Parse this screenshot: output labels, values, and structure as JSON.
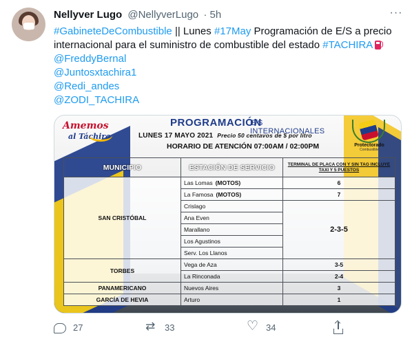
{
  "tweet": {
    "author_name": "Nellyver Lugo",
    "author_handle": "@NellyverLugo",
    "time": "· 5h",
    "more_icon": "more-horizontal-icon",
    "text": {
      "l1_hashtag1": "#GabineteDeCombustible",
      "l1_mid": " || Lunes ",
      "l1_hashtag2": "#17May",
      "l1_rest": " Programación de E/S a precio",
      "l2_text": "internacional para el suministro de combustible  del estado ",
      "l2_hashtag": "#TACHIRA",
      "l2_emoji": "fuel-pump-icon",
      "mentions": [
        "@FreddyBernal",
        "@Juntosxtachira1",
        "@Redi_andes",
        "@ZODI_TACHIRA"
      ]
    },
    "colors": {
      "link": "#1d9bf0",
      "secondary": "#536471",
      "text": "#0f1419"
    }
  },
  "image": {
    "logo_left_line1": "Amemos",
    "logo_left_line2": "al Táchira",
    "title": "PROGRAMACIÓN",
    "subtitle": "E/S INTERNACIONALES",
    "date": "LUNES  17  MAYO 2021",
    "price_note": "Precio 50 centavos de $ por litro",
    "hours": "HORARIO DE ATENCIÓN 07:00AM / 02:00PM",
    "logo_right_line1": "Protectorado",
    "logo_right_line2": "Combustible",
    "table": {
      "headers": [
        "MUNICIPIO",
        "ESTACIÓN DE SERVICIO",
        "TERMINAL DE PLACA CON Y SIN TAG INCLUYE TAXI Y 5 PUESTOS"
      ],
      "municipalities": [
        "SAN CRISTÓBAL",
        "TORBES",
        "PANAMERICANO",
        "GARCÍA DE HEVIA"
      ],
      "stations": [
        {
          "name": "Las Lomas",
          "note": "(MOTOS)",
          "terminal": "6"
        },
        {
          "name": "La Famosa",
          "note": "(MOTOS)",
          "terminal": "7"
        },
        {
          "name": "Crislago",
          "note": "",
          "terminal": ""
        },
        {
          "name": "Ana Even",
          "note": "",
          "terminal": ""
        },
        {
          "name": "Marallano",
          "note": "",
          "terminal": "2-3-5"
        },
        {
          "name": "Los Agustinos",
          "note": "",
          "terminal": ""
        },
        {
          "name": "Serv. Los Llanos",
          "note": "",
          "terminal": ""
        },
        {
          "name": "Vega de Aza",
          "note": "",
          "terminal": "3-5"
        },
        {
          "name": "La Rinconada",
          "note": "",
          "terminal": "2-4"
        },
        {
          "name": "Nuevos Aires",
          "note": "",
          "terminal": "3"
        },
        {
          "name": "Arturo",
          "note": "",
          "terminal": "1"
        }
      ]
    }
  },
  "actions": {
    "reply_count": "27",
    "retweet_count": "33",
    "like_count": "34",
    "icons": [
      "reply-icon",
      "retweet-icon",
      "like-icon",
      "share-icon"
    ]
  }
}
